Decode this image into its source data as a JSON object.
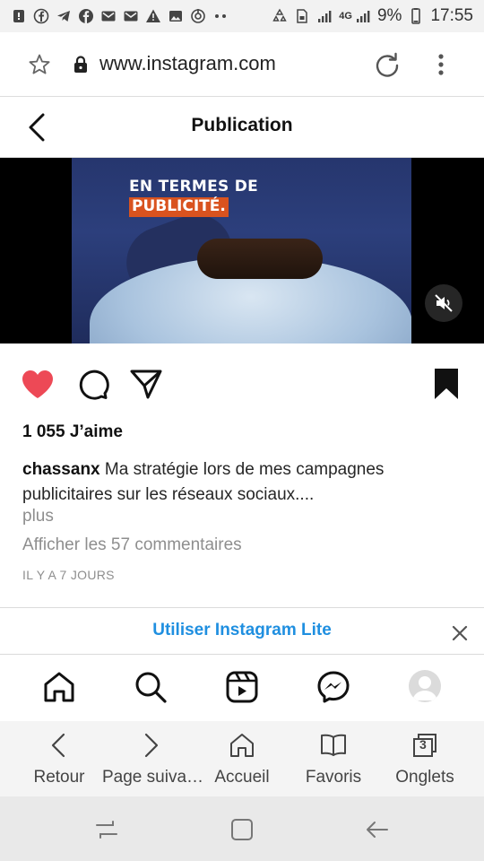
{
  "status_bar": {
    "battery": "9%",
    "time": "17:55",
    "network": "4G",
    "left_icons": [
      "notification-icon",
      "facebook-icon",
      "telegram-icon",
      "facebook-icon",
      "gmail-icon",
      "gmail-icon",
      "warning-icon",
      "image-icon",
      "sync-icon",
      "dots-icon"
    ],
    "right_icons": [
      "recycle-icon",
      "sim-icon",
      "signal-icon",
      "signal-4g-icon",
      "battery-icon"
    ]
  },
  "browser": {
    "url": "www.instagram.com",
    "icons": [
      "star-icon",
      "lock-icon",
      "reload-icon",
      "kebab-icon"
    ]
  },
  "header": {
    "title": "Publication",
    "back_icon": "chevron-left-icon"
  },
  "media": {
    "overlay_line1": "EN TERMES DE",
    "overlay_line2": "PUBLICITÉ.",
    "overlay_highlight": "#d9531f",
    "mute_icon": "speaker-muted-icon"
  },
  "actions": {
    "icons": [
      "heart-filled-icon",
      "comment-icon",
      "share-icon",
      "bookmark-filled-icon"
    ],
    "heart_color": "#ed4956"
  },
  "post": {
    "likes": "1 055 J’aime",
    "username": "chassanx",
    "caption": " Ma stratégie lors de mes campagnes publicitaires sur les réseaux sociaux....",
    "more": "plus",
    "view_comments": "Afficher les 57 commentaires",
    "timestamp": "IL Y A 7 JOURS"
  },
  "lite_banner": {
    "label": "Utiliser Instagram Lite",
    "color": "#1f8fe0"
  },
  "ig_nav": {
    "items": [
      "home-icon",
      "search-icon",
      "reels-icon",
      "messenger-icon",
      "avatar"
    ]
  },
  "browser_nav": {
    "items": [
      {
        "label": "Retour",
        "icon": "chevron-left-icon"
      },
      {
        "label": "Page suiva…",
        "icon": "chevron-right-icon"
      },
      {
        "label": "Accueil",
        "icon": "home-icon"
      },
      {
        "label": "Favoris",
        "icon": "book-icon"
      },
      {
        "label": "Onglets",
        "icon": "tabs-icon",
        "count": "3"
      }
    ]
  },
  "system_nav": {
    "items": [
      "recents-icon",
      "home-square-icon",
      "back-arrow-icon"
    ]
  }
}
